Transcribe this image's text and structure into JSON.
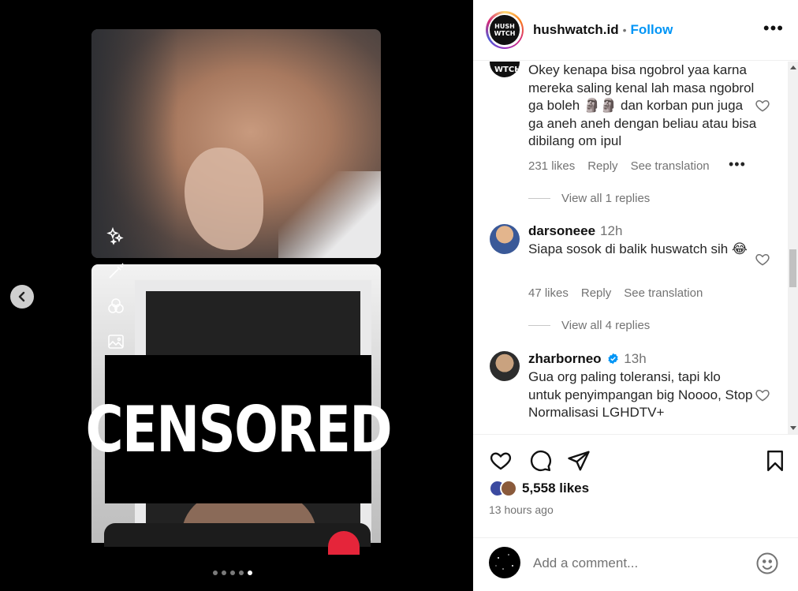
{
  "post": {
    "username": "hushwatch.id",
    "logo_text": "HUSH WTCH",
    "follow_label": "Follow",
    "more_icon": "more-horizontal-icon"
  },
  "media": {
    "censor_text": "CENSORED",
    "carousel": {
      "count": 5,
      "active_index": 4
    }
  },
  "comments": [
    {
      "username": "",
      "time": "",
      "text": "Okey kenapa bisa ngobrol yaa karna mereka saling kenal lah masa ngobrol ga boleh 🗿🗿 dan korban pun juga ga aneh aneh dengan beliau atau bisa dibilang om ipul",
      "likes": "231 likes",
      "reply": "Reply",
      "translate": "See translation",
      "view_replies": "View all 1 replies"
    },
    {
      "username": "darsoneee",
      "time": "12h",
      "text": "Siapa sosok di balik huswatch sih 😂",
      "likes": "47 likes",
      "reply": "Reply",
      "translate": "See translation",
      "view_replies": "View all 4 replies"
    },
    {
      "username": "zharborneo",
      "time": "13h",
      "verified": true,
      "text": "Gua org paling toleransi, tapi klo untuk penyimpangan big Noooo, Stop Normalisasi LGHDTV+"
    }
  ],
  "stats": {
    "likes": "5,558 likes",
    "time_ago": "13 hours ago"
  },
  "composer": {
    "placeholder": "Add a comment..."
  },
  "colors": {
    "accent": "#0095f6",
    "text": "#262626",
    "muted": "#737373"
  }
}
